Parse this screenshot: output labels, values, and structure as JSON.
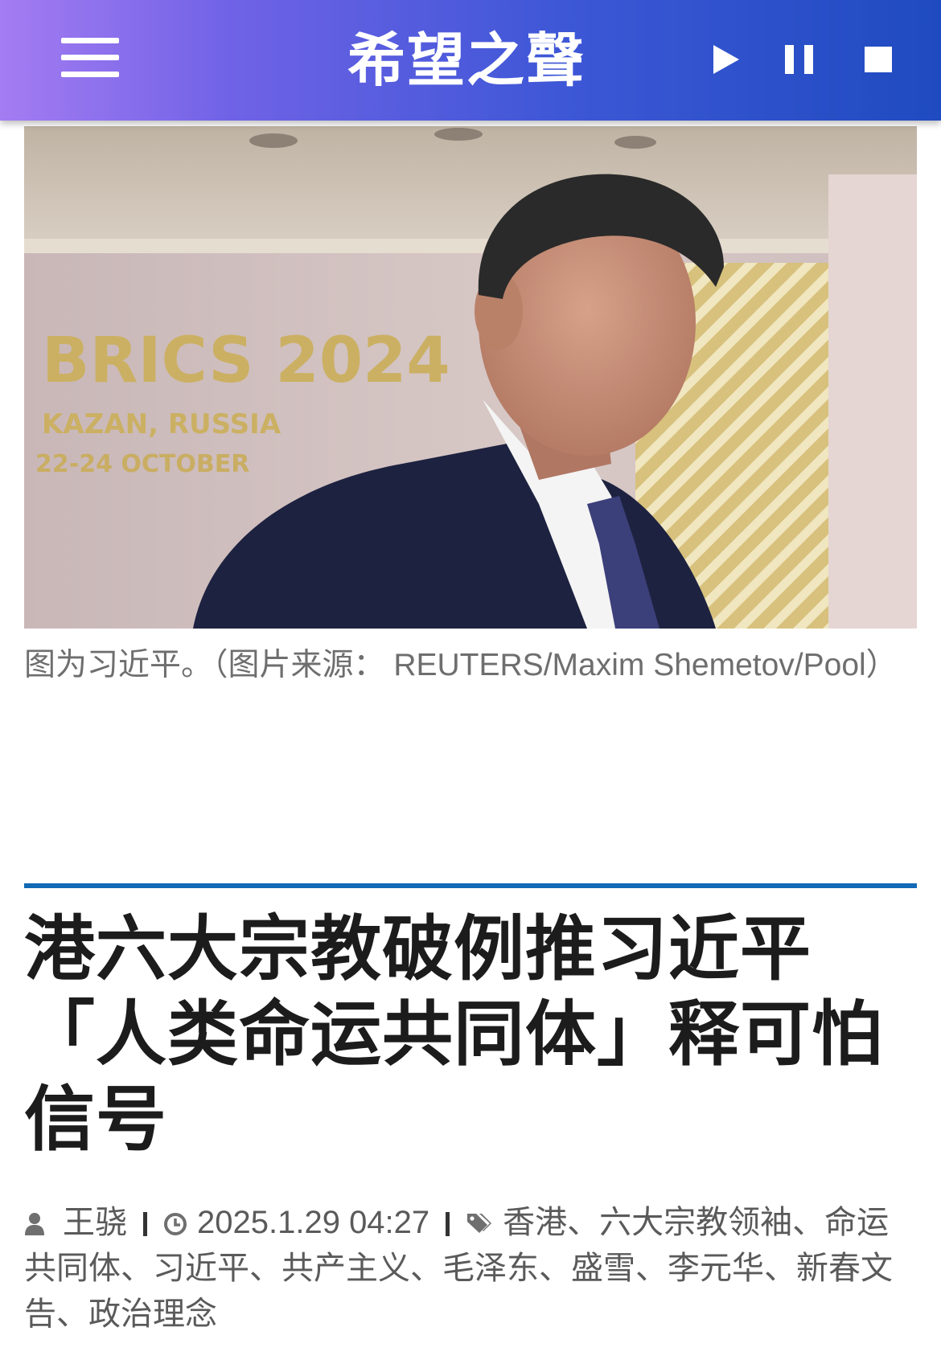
{
  "header": {
    "logo_text": "希望之聲",
    "menu_icon": "hamburger-menu-icon",
    "play_icon": "play-icon",
    "pause_icon": "pause-icon",
    "stop_icon": "stop-icon",
    "gradient_colors": [
      "#a47cf2",
      "#3d57d6",
      "#1f4bc0"
    ]
  },
  "hero": {
    "sign_line1": "BRICS 2024",
    "sign_line2": "KAZAN, RUSSIA",
    "sign_line3": "22-24 OCTOBER"
  },
  "caption": "图为习近平。（图片来源： REUTERS/Maxim Shemetov/Pool）",
  "article": {
    "title": "港六大宗教破例推习近平「人类命运共同体」释可怕信号",
    "author": "王骁",
    "datetime": "2025.1.29 04:27",
    "tags": [
      "香港",
      "六大宗教领袖",
      "命运共同体",
      "习近平",
      "共产主义",
      "毛泽东",
      "盛雪",
      "李元华",
      "新春文告",
      "政治理念"
    ],
    "tag_separator": "、"
  },
  "colors": {
    "divider": "#1269b5",
    "title": "#1c1c1c",
    "meta": "#5a5a5a"
  }
}
